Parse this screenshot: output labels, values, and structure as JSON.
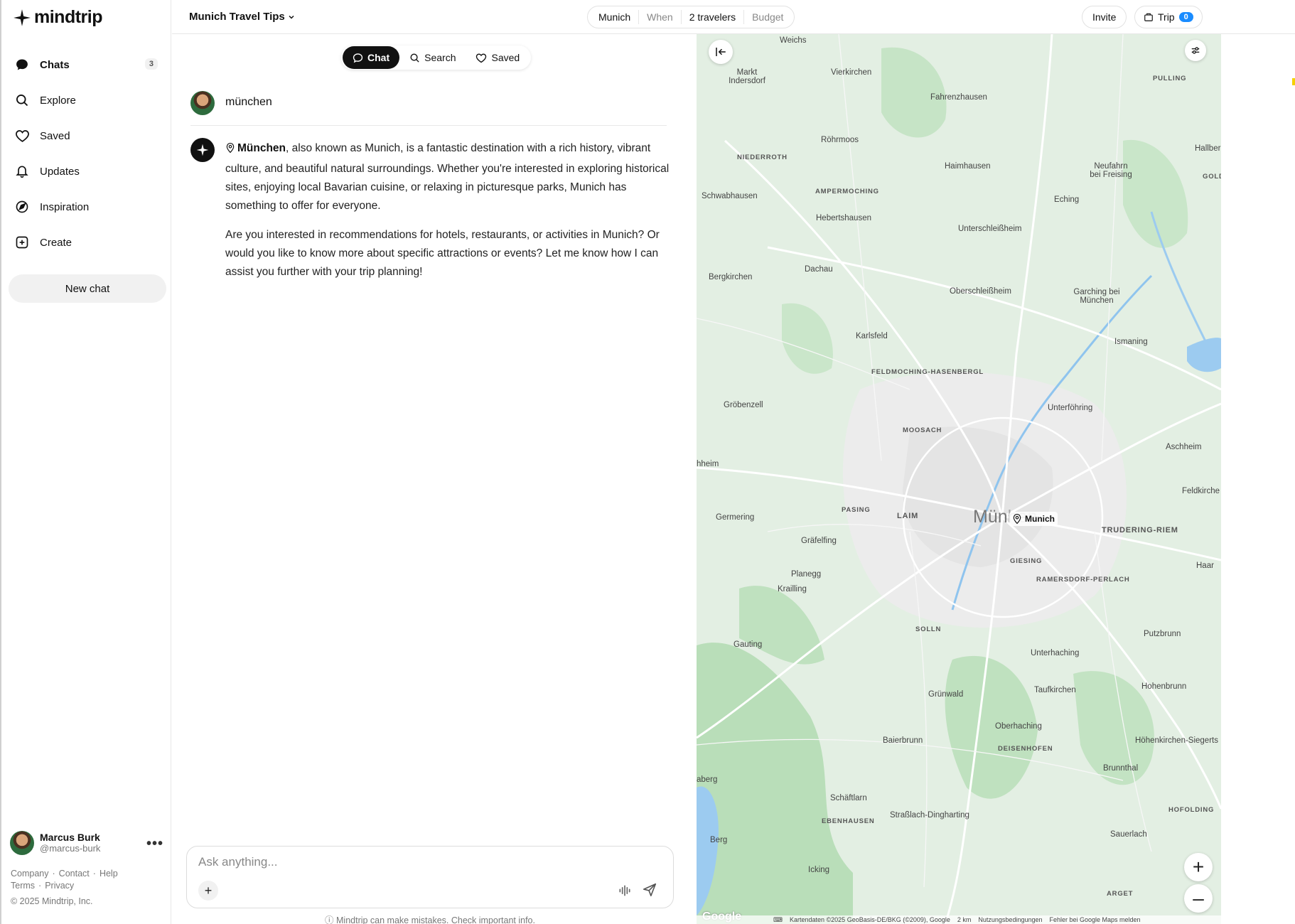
{
  "app": {
    "logo_text": "mindtrip",
    "brand_color": "#111111",
    "accent_color": "#1a8cff"
  },
  "sidebar": {
    "items": [
      {
        "label": "Chats",
        "icon": "chat-bubble-icon",
        "count": "3",
        "active": true
      },
      {
        "label": "Explore",
        "icon": "search-icon"
      },
      {
        "label": "Saved",
        "icon": "heart-icon"
      },
      {
        "label": "Updates",
        "icon": "bell-icon"
      },
      {
        "label": "Inspiration",
        "icon": "compass-icon"
      },
      {
        "label": "Create",
        "icon": "plus-square-icon"
      }
    ],
    "new_chat_label": "New chat",
    "profile": {
      "name": "Marcus Burk",
      "handle": "@marcus-burk"
    },
    "footer": {
      "company": "Company",
      "contact": "Contact",
      "help": "Help",
      "terms": "Terms",
      "privacy": "Privacy",
      "copyright": "© 2025 Mindtrip, Inc."
    }
  },
  "topbar": {
    "trip_title": "Munich Travel Tips",
    "destination": "Munich",
    "when": "When",
    "travelers": "2 travelers",
    "budget": "Budget",
    "invite_label": "Invite",
    "trip_label": "Trip",
    "trip_count": "0"
  },
  "chat": {
    "tabs": [
      {
        "label": "Chat",
        "icon": "chat-bubble-icon",
        "active": true
      },
      {
        "label": "Search",
        "icon": "search-icon"
      },
      {
        "label": "Saved",
        "icon": "heart-icon"
      }
    ],
    "user_message": "münchen",
    "ai_place": "München",
    "ai_paragraph_1_rest": ", also known as Munich, is a fantastic destination with a rich history, vibrant culture, and beautiful natural surroundings. Whether you're interested in exploring historical sites, enjoying local Bavarian cuisine, or relaxing in picturesque parks, Munich has something to offer for everyone.",
    "ai_paragraph_2": "Are you interested in recommendations for hotels, restaurants, or activities in Munich? Or would you like to know more about specific attractions or events? Let me know how I can assist you further with your trip planning!",
    "composer_placeholder": "Ask anything...",
    "disclaimer": "Mindtrip can make mistakes. Check important info."
  },
  "map": {
    "city_big": "Mün",
    "city_big_tail": "hen",
    "pin_label": "Munich",
    "labels": [
      "Weichs",
      "Markt Indersdorf",
      "Vierkirchen",
      "Fahrenzhausen",
      "PULLING",
      "Hallber",
      "Röhrmoos",
      "NIEDERROTH",
      "Haimhausen",
      "Neufahrn bei Freising",
      "GOLD",
      "AMPERMOCHING",
      "Schwabhausen",
      "Eching",
      "Hebertshausen",
      "Unterschleißheim",
      "Dachau",
      "Bergkirchen",
      "Oberschleißheim",
      "Garching bei München",
      "Karlsfeld",
      "Ismaning",
      "FELDMOCHING-HASENBERGL",
      "Gröbenzell",
      "Unterföhring",
      "MOOSACH",
      "Aschheim",
      "hheim",
      "Feldkirche",
      "PASING",
      "LAIM",
      "Germering",
      "TRUDERING-RIEM",
      "Gräfelfing",
      "GIESING",
      "Haar",
      "Planegg",
      "RAMERSDORF-PERLACH",
      "Krailling",
      "SOLLN",
      "Putzbrunn",
      "Gauting",
      "Unterhaching",
      "Taufkirchen",
      "Hohenbrunn",
      "Grünwald",
      "Oberhaching",
      "Baierbrunn",
      "Höhenkirchen-Siegerts",
      "DEISENHOFEN",
      "aberg",
      "Brunnthal",
      "Schäftlarn",
      "HOFOLDING",
      "Straßlach-Dingharting",
      "EBENHAUSEN",
      "Sauerlach",
      "Berg",
      "Icking",
      "ARGET"
    ],
    "attribution": "Kartendaten ©2025 GeoBasis-DE/BKG (©2009), Google",
    "scale": "2 km",
    "terms": "Nutzungsbedingungen",
    "report": "Fehler bei Google Maps melden",
    "google": "Google"
  }
}
